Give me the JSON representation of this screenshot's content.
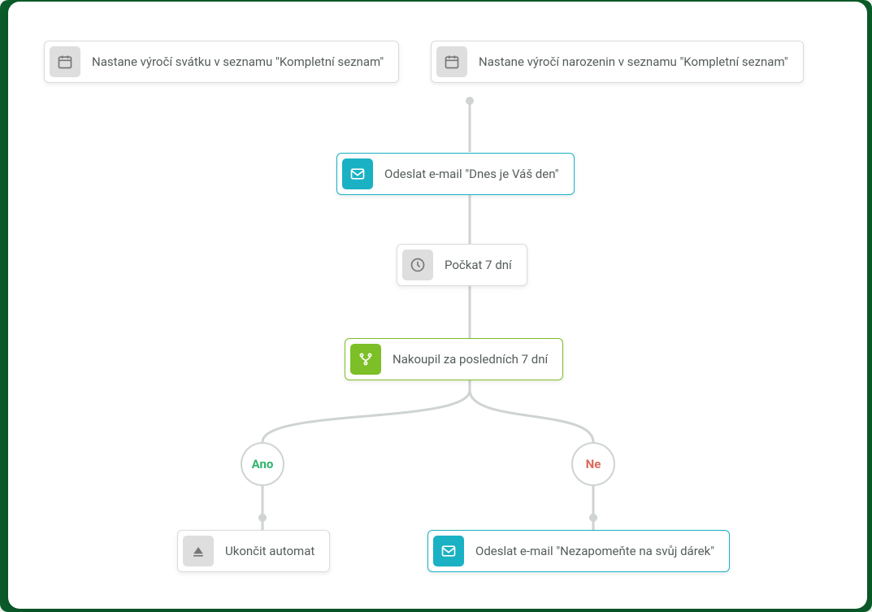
{
  "triggers": {
    "left": {
      "label": "Nastane výročí svátku v seznamu \"Kompletní seznam\""
    },
    "right": {
      "label": "Nastane výročí narozenin v seznamu \"Kompletní seznam\""
    }
  },
  "steps": {
    "sendToday": {
      "label": "Odeslat e-mail \"Dnes je Váš den\""
    },
    "wait": {
      "label": "Počkat 7 dní"
    },
    "condition": {
      "label": "Nakoupil za posledních 7 dní"
    },
    "yes": {
      "label": "Ano"
    },
    "no": {
      "label": "Ne"
    },
    "end": {
      "label": "Ukončit automat"
    },
    "sendReminder": {
      "label": "Odeslat e-mail \"Nezapomeňte na svůj dárek\""
    }
  },
  "colors": {
    "teal": "#1ab1c4",
    "green": "#7cbf26",
    "conn": "#cfd3d3"
  }
}
